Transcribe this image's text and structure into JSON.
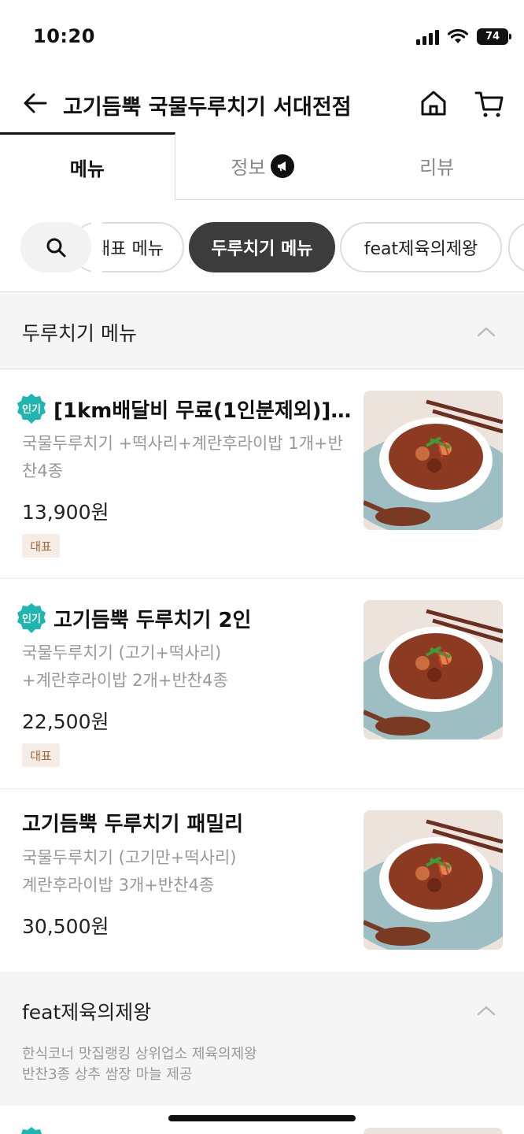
{
  "status_bar": {
    "time": "10:20",
    "battery": "74"
  },
  "header": {
    "title": "고기듬뿍 국물두루치기 서대전점"
  },
  "tabs": [
    {
      "label": "메뉴",
      "active": true
    },
    {
      "label": "정보",
      "active": false
    },
    {
      "label": "리뷰",
      "active": false
    }
  ],
  "chips": [
    {
      "label": "대표 메뉴",
      "active": false
    },
    {
      "label": "두루치기 메뉴",
      "active": true
    },
    {
      "label": "feat제육의제왕",
      "active": false
    }
  ],
  "sections": [
    {
      "title": "두루치기 메뉴",
      "items": [
        {
          "popular": "인기",
          "name": "[1km배달비 무료(1인분제외)]…",
          "desc_line1": "국물두루치기 +떡사리+계란후라이밥 1개+반",
          "desc_line2": "찬4종",
          "price": "13,900원",
          "tag": "대표"
        },
        {
          "popular": "인기",
          "name": "고기듬뿍 두루치기 2인",
          "desc_line1": "국물두루치기 (고기+떡사리)",
          "desc_line2": "+계란후라이밥 2개+반찬4종",
          "price": "22,500원",
          "tag": "대표"
        },
        {
          "popular": "",
          "name": "고기듬뿍 두루치기 패밀리",
          "desc_line1": "국물두루치기 (고기만+떡사리)",
          "desc_line2": "계란후라이밥 3개+반찬4종",
          "price": "30,500원",
          "tag": ""
        }
      ]
    },
    {
      "title": "feat제육의제왕",
      "desc_line1": "한식코너 맛집랭킹 상위업소 제육의제왕",
      "desc_line2": "반찬3종 상추 쌈장 마늘 제공"
    }
  ],
  "colors": {
    "popular_badge": "#1fb5b0",
    "active_chip": "#3c3c3c",
    "rep_tag_bg": "#f6ece6",
    "rep_tag_text": "#a0673f"
  }
}
